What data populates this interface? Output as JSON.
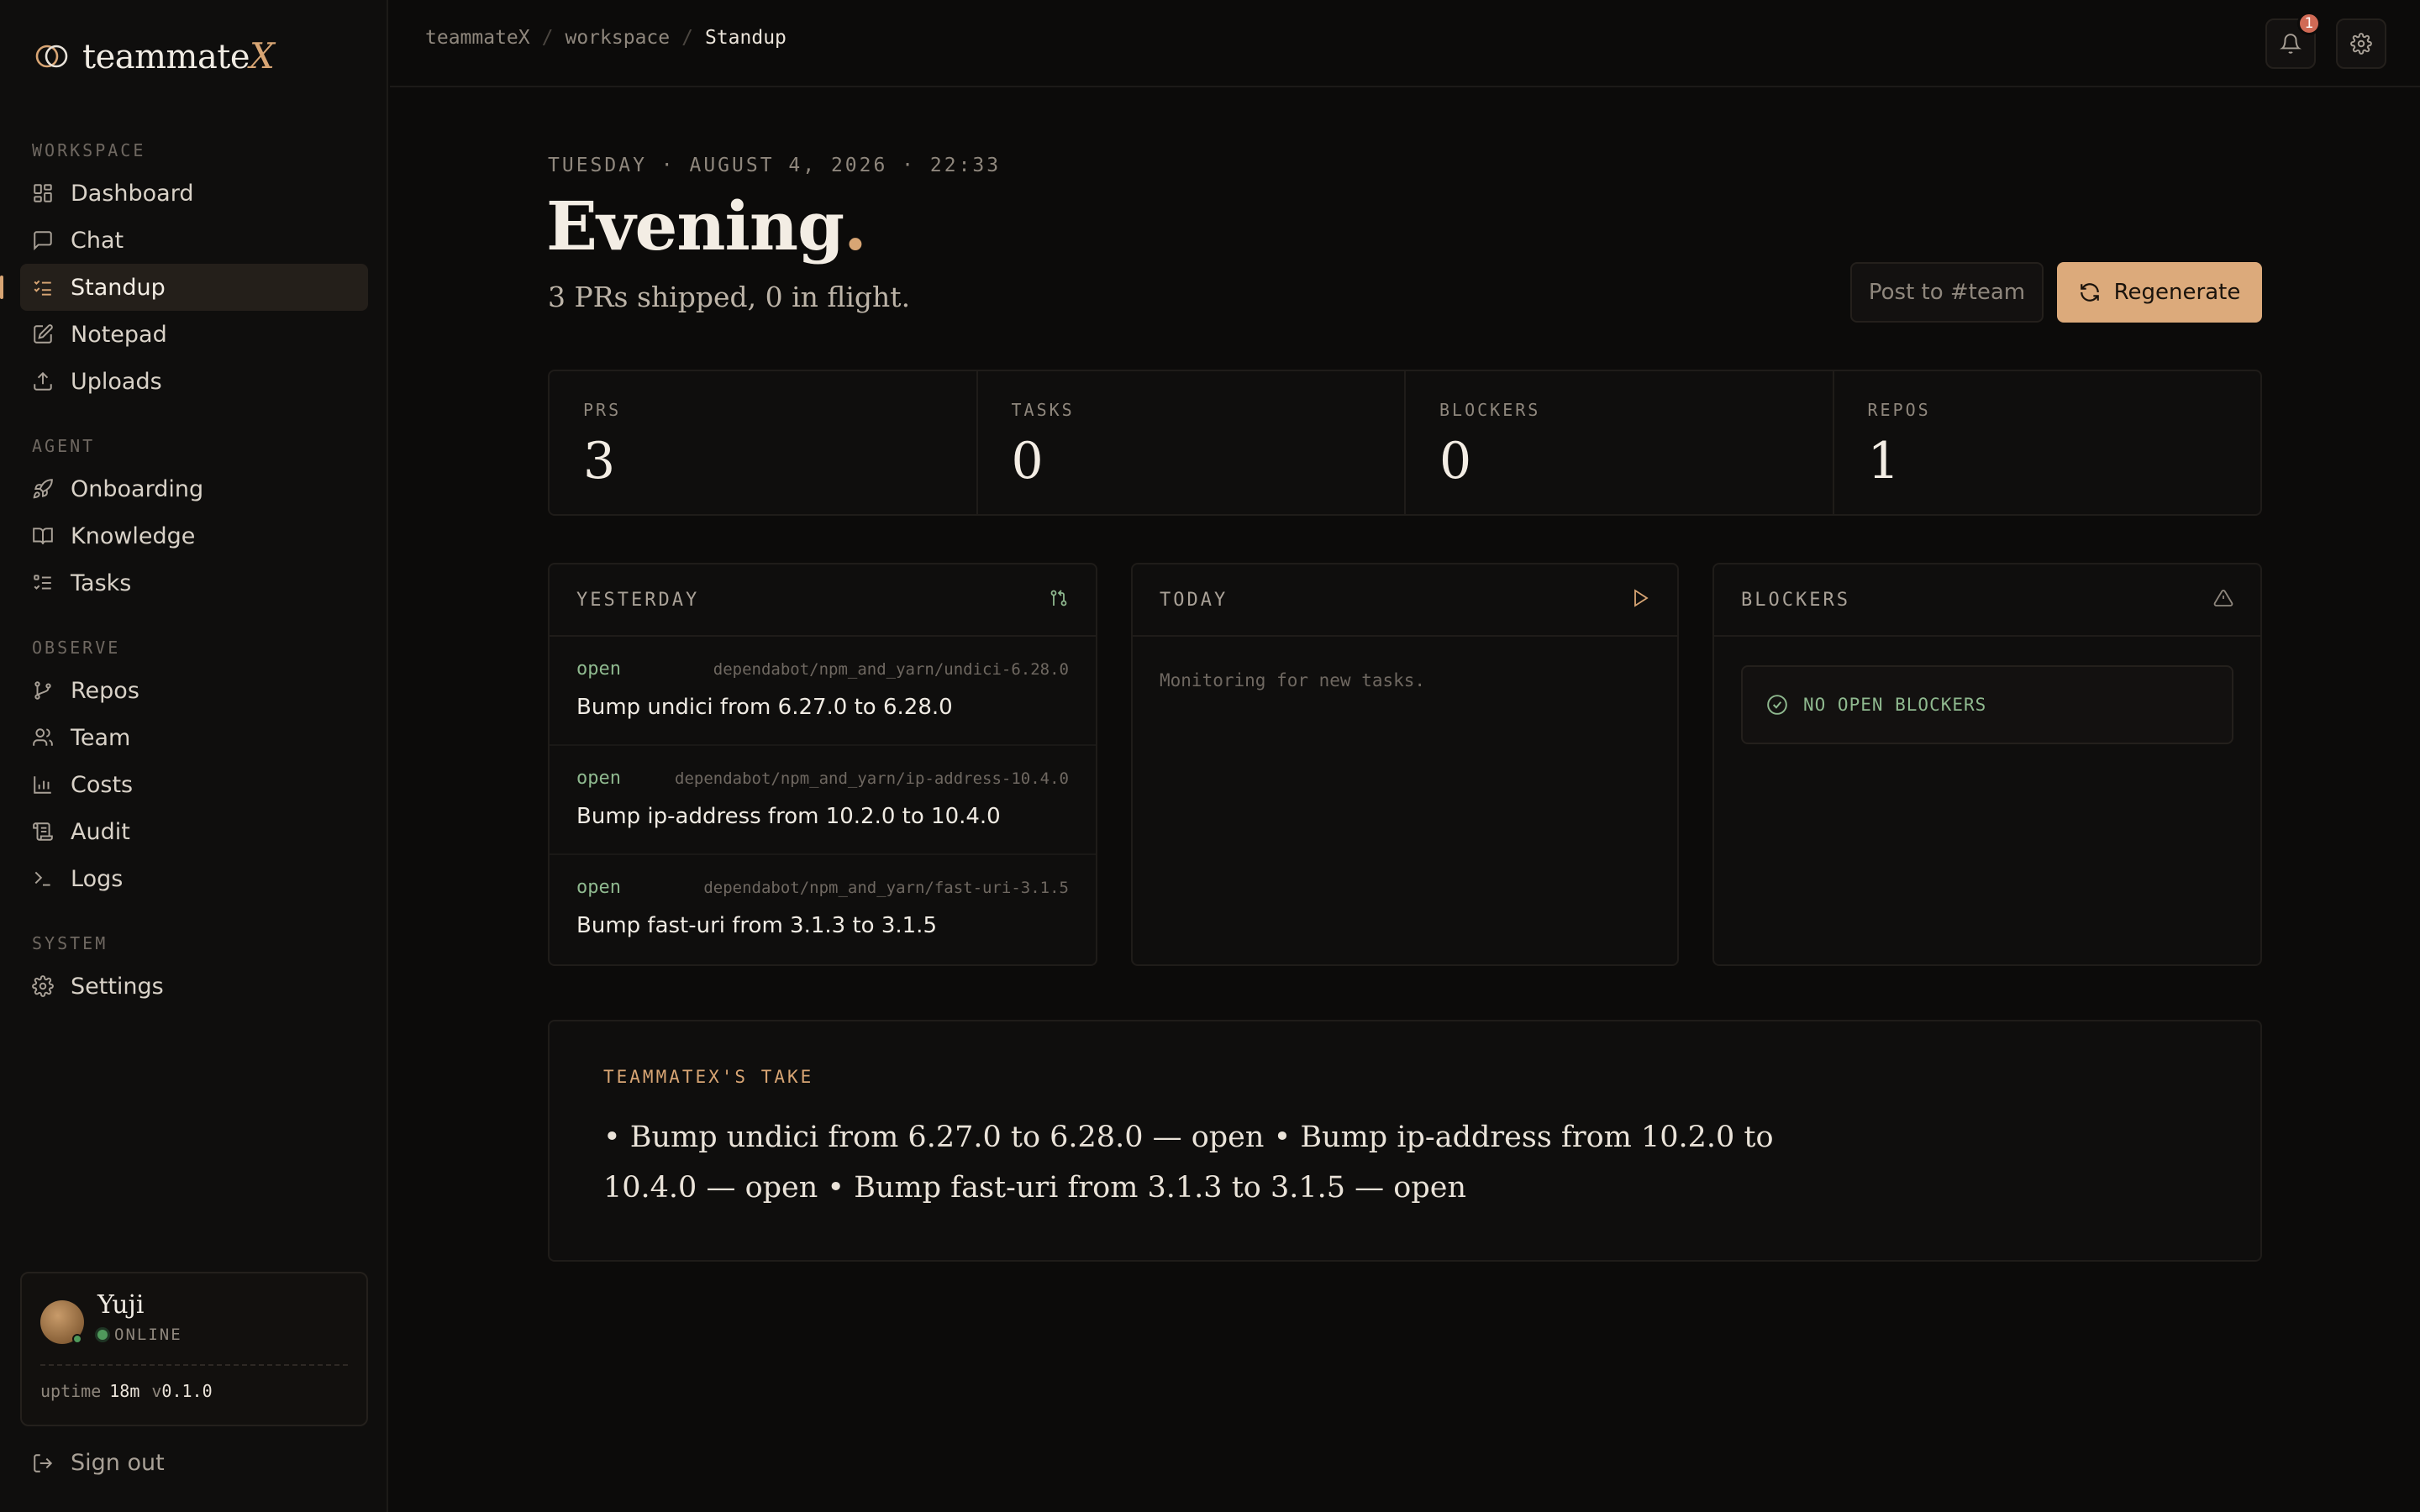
{
  "app": {
    "name": "teammate",
    "name_suffix": "X"
  },
  "sidebar": {
    "sections": [
      {
        "label": "WORKSPACE",
        "items": [
          {
            "label": "Dashboard",
            "icon": "dashboard-icon"
          },
          {
            "label": "Chat",
            "icon": "chat-icon"
          },
          {
            "label": "Standup",
            "icon": "standup-icon",
            "active": true
          },
          {
            "label": "Notepad",
            "icon": "notepad-icon"
          },
          {
            "label": "Uploads",
            "icon": "upload-icon"
          }
        ]
      },
      {
        "label": "AGENT",
        "items": [
          {
            "label": "Onboarding",
            "icon": "rocket-icon"
          },
          {
            "label": "Knowledge",
            "icon": "book-icon"
          },
          {
            "label": "Tasks",
            "icon": "tasks-icon"
          }
        ]
      },
      {
        "label": "OBSERVE",
        "items": [
          {
            "label": "Repos",
            "icon": "git-branch-icon"
          },
          {
            "label": "Team",
            "icon": "users-icon"
          },
          {
            "label": "Costs",
            "icon": "bar-chart-icon"
          },
          {
            "label": "Audit",
            "icon": "audit-icon"
          },
          {
            "label": "Logs",
            "icon": "terminal-icon"
          }
        ]
      },
      {
        "label": "SYSTEM",
        "items": [
          {
            "label": "Settings",
            "icon": "gear-icon"
          }
        ]
      }
    ],
    "user": {
      "name": "Yuji",
      "status": "ONLINE",
      "uptime_label": "uptime",
      "uptime": "18m",
      "version_prefix": "v",
      "version": "0.1.0"
    },
    "signout": "Sign out"
  },
  "topbar": {
    "breadcrumb": [
      "teammateX",
      "workspace",
      "Standup"
    ],
    "notification_count": "1"
  },
  "main": {
    "date": "TUESDAY · AUGUST 4, 2026 · 22:33",
    "greeting": "Evening",
    "greeting_dot": ".",
    "summary": "3 PRs shipped, 0 in flight.",
    "post_button": "Post to #team",
    "regenerate_button": "Regenerate",
    "stats": [
      {
        "label": "PRS",
        "value": "3"
      },
      {
        "label": "TASKS",
        "value": "0"
      },
      {
        "label": "BLOCKERS",
        "value": "0"
      },
      {
        "label": "REPOS",
        "value": "1"
      }
    ],
    "yesterday": {
      "title": "YESTERDAY",
      "items": [
        {
          "status": "open",
          "branch": "dependabot/npm_and_yarn/undici-6.28.0",
          "title": "Bump undici from 6.27.0 to 6.28.0"
        },
        {
          "status": "open",
          "branch": "dependabot/npm_and_yarn/ip-address-10.4.0",
          "title": "Bump ip-address from 10.2.0 to 10.4.0"
        },
        {
          "status": "open",
          "branch": "dependabot/npm_and_yarn/fast-uri-3.1.5",
          "title": "Bump fast-uri from 3.1.3 to 3.1.5"
        }
      ]
    },
    "today": {
      "title": "TODAY",
      "empty_text": "Monitoring for new tasks."
    },
    "blockers": {
      "title": "BLOCKERS",
      "empty_text": "NO OPEN BLOCKERS"
    },
    "take": {
      "label": "TEAMMATEX'S TAKE",
      "text": "• Bump undici from 6.27.0 to 6.28.0 — open • Bump ip-address from 10.2.0 to 10.4.0 — open • Bump fast-uri from 3.1.3 to 3.1.5 — open"
    }
  },
  "colors": {
    "accent": "#d8a574",
    "status_open": "#8fb98f",
    "background": "#0c0b0a",
    "badge": "#d06a55"
  }
}
